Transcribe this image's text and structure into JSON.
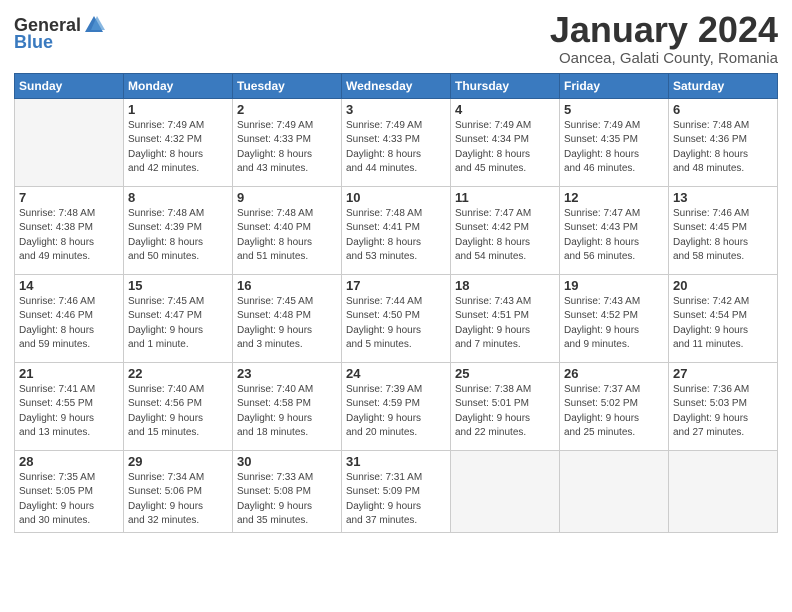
{
  "logo": {
    "general": "General",
    "blue": "Blue"
  },
  "header": {
    "month": "January 2024",
    "location": "Oancea, Galati County, Romania"
  },
  "weekdays": [
    "Sunday",
    "Monday",
    "Tuesday",
    "Wednesday",
    "Thursday",
    "Friday",
    "Saturday"
  ],
  "weeks": [
    [
      {
        "day": null,
        "info": null
      },
      {
        "day": "1",
        "info": "Sunrise: 7:49 AM\nSunset: 4:32 PM\nDaylight: 8 hours\nand 42 minutes."
      },
      {
        "day": "2",
        "info": "Sunrise: 7:49 AM\nSunset: 4:33 PM\nDaylight: 8 hours\nand 43 minutes."
      },
      {
        "day": "3",
        "info": "Sunrise: 7:49 AM\nSunset: 4:33 PM\nDaylight: 8 hours\nand 44 minutes."
      },
      {
        "day": "4",
        "info": "Sunrise: 7:49 AM\nSunset: 4:34 PM\nDaylight: 8 hours\nand 45 minutes."
      },
      {
        "day": "5",
        "info": "Sunrise: 7:49 AM\nSunset: 4:35 PM\nDaylight: 8 hours\nand 46 minutes."
      },
      {
        "day": "6",
        "info": "Sunrise: 7:48 AM\nSunset: 4:36 PM\nDaylight: 8 hours\nand 48 minutes."
      }
    ],
    [
      {
        "day": "7",
        "info": "Sunrise: 7:48 AM\nSunset: 4:38 PM\nDaylight: 8 hours\nand 49 minutes."
      },
      {
        "day": "8",
        "info": "Sunrise: 7:48 AM\nSunset: 4:39 PM\nDaylight: 8 hours\nand 50 minutes."
      },
      {
        "day": "9",
        "info": "Sunrise: 7:48 AM\nSunset: 4:40 PM\nDaylight: 8 hours\nand 51 minutes."
      },
      {
        "day": "10",
        "info": "Sunrise: 7:48 AM\nSunset: 4:41 PM\nDaylight: 8 hours\nand 53 minutes."
      },
      {
        "day": "11",
        "info": "Sunrise: 7:47 AM\nSunset: 4:42 PM\nDaylight: 8 hours\nand 54 minutes."
      },
      {
        "day": "12",
        "info": "Sunrise: 7:47 AM\nSunset: 4:43 PM\nDaylight: 8 hours\nand 56 minutes."
      },
      {
        "day": "13",
        "info": "Sunrise: 7:46 AM\nSunset: 4:45 PM\nDaylight: 8 hours\nand 58 minutes."
      }
    ],
    [
      {
        "day": "14",
        "info": "Sunrise: 7:46 AM\nSunset: 4:46 PM\nDaylight: 8 hours\nand 59 minutes."
      },
      {
        "day": "15",
        "info": "Sunrise: 7:45 AM\nSunset: 4:47 PM\nDaylight: 9 hours\nand 1 minute."
      },
      {
        "day": "16",
        "info": "Sunrise: 7:45 AM\nSunset: 4:48 PM\nDaylight: 9 hours\nand 3 minutes."
      },
      {
        "day": "17",
        "info": "Sunrise: 7:44 AM\nSunset: 4:50 PM\nDaylight: 9 hours\nand 5 minutes."
      },
      {
        "day": "18",
        "info": "Sunrise: 7:43 AM\nSunset: 4:51 PM\nDaylight: 9 hours\nand 7 minutes."
      },
      {
        "day": "19",
        "info": "Sunrise: 7:43 AM\nSunset: 4:52 PM\nDaylight: 9 hours\nand 9 minutes."
      },
      {
        "day": "20",
        "info": "Sunrise: 7:42 AM\nSunset: 4:54 PM\nDaylight: 9 hours\nand 11 minutes."
      }
    ],
    [
      {
        "day": "21",
        "info": "Sunrise: 7:41 AM\nSunset: 4:55 PM\nDaylight: 9 hours\nand 13 minutes."
      },
      {
        "day": "22",
        "info": "Sunrise: 7:40 AM\nSunset: 4:56 PM\nDaylight: 9 hours\nand 15 minutes."
      },
      {
        "day": "23",
        "info": "Sunrise: 7:40 AM\nSunset: 4:58 PM\nDaylight: 9 hours\nand 18 minutes."
      },
      {
        "day": "24",
        "info": "Sunrise: 7:39 AM\nSunset: 4:59 PM\nDaylight: 9 hours\nand 20 minutes."
      },
      {
        "day": "25",
        "info": "Sunrise: 7:38 AM\nSunset: 5:01 PM\nDaylight: 9 hours\nand 22 minutes."
      },
      {
        "day": "26",
        "info": "Sunrise: 7:37 AM\nSunset: 5:02 PM\nDaylight: 9 hours\nand 25 minutes."
      },
      {
        "day": "27",
        "info": "Sunrise: 7:36 AM\nSunset: 5:03 PM\nDaylight: 9 hours\nand 27 minutes."
      }
    ],
    [
      {
        "day": "28",
        "info": "Sunrise: 7:35 AM\nSunset: 5:05 PM\nDaylight: 9 hours\nand 30 minutes."
      },
      {
        "day": "29",
        "info": "Sunrise: 7:34 AM\nSunset: 5:06 PM\nDaylight: 9 hours\nand 32 minutes."
      },
      {
        "day": "30",
        "info": "Sunrise: 7:33 AM\nSunset: 5:08 PM\nDaylight: 9 hours\nand 35 minutes."
      },
      {
        "day": "31",
        "info": "Sunrise: 7:31 AM\nSunset: 5:09 PM\nDaylight: 9 hours\nand 37 minutes."
      },
      {
        "day": null,
        "info": null
      },
      {
        "day": null,
        "info": null
      },
      {
        "day": null,
        "info": null
      }
    ]
  ]
}
